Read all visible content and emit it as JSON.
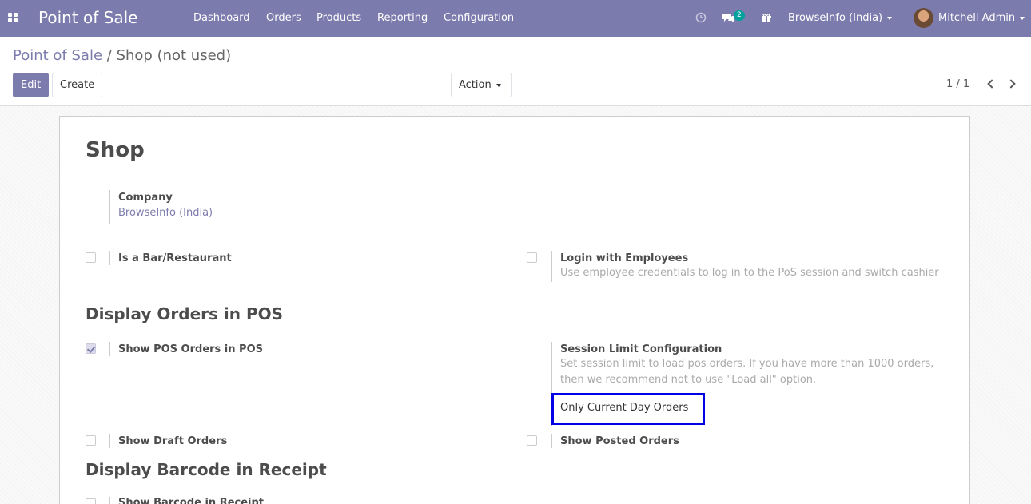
{
  "navbar": {
    "app_name": "Point of Sale",
    "menu": [
      "Dashboard",
      "Orders",
      "Products",
      "Reporting",
      "Configuration"
    ],
    "messages_badge": "2",
    "company": "BrowseInfo (India)",
    "user": "Mitchell Admin",
    "icons": [
      "apps-grid-icon",
      "clock-icon",
      "chat-icon",
      "gift-icon"
    ]
  },
  "breadcrumb": {
    "parent": "Point of Sale",
    "separator": "/",
    "current": "Shop (not used)"
  },
  "buttons": {
    "edit": "Edit",
    "create": "Create",
    "action": "Action"
  },
  "pager": {
    "value": "1 / 1"
  },
  "form": {
    "title": "Shop",
    "company_label": "Company",
    "company_value": "BrowseInfo (India)",
    "bar_label": "Is a Bar/Restaurant",
    "bar_checked": false,
    "login_label": "Login with Employees",
    "login_help": "Use employee credentials to log in to the PoS session and switch cashier",
    "login_checked": false,
    "section_display_orders": "Display Orders in POS",
    "show_pos_orders_label": "Show POS Orders in POS",
    "show_pos_orders_checked": true,
    "session_limit_label": "Session Limit Configuration",
    "session_limit_help_1": "Set session limit to load pos orders. If you have more than 1000 orders,",
    "session_limit_help_2": "then we recommend not to use \"Load all\" option.",
    "session_limit_value": "Only Current Day Orders",
    "show_draft_label": "Show Draft Orders",
    "show_draft_checked": false,
    "show_posted_label": "Show Posted Orders",
    "show_posted_checked": false,
    "section_barcode": "Display Barcode in Receipt",
    "show_barcode_label": "Show Barcode in Receipt"
  },
  "colors": {
    "primary": "#7c7bad",
    "badge": "#00a09d",
    "highlight": "#0000e6"
  }
}
